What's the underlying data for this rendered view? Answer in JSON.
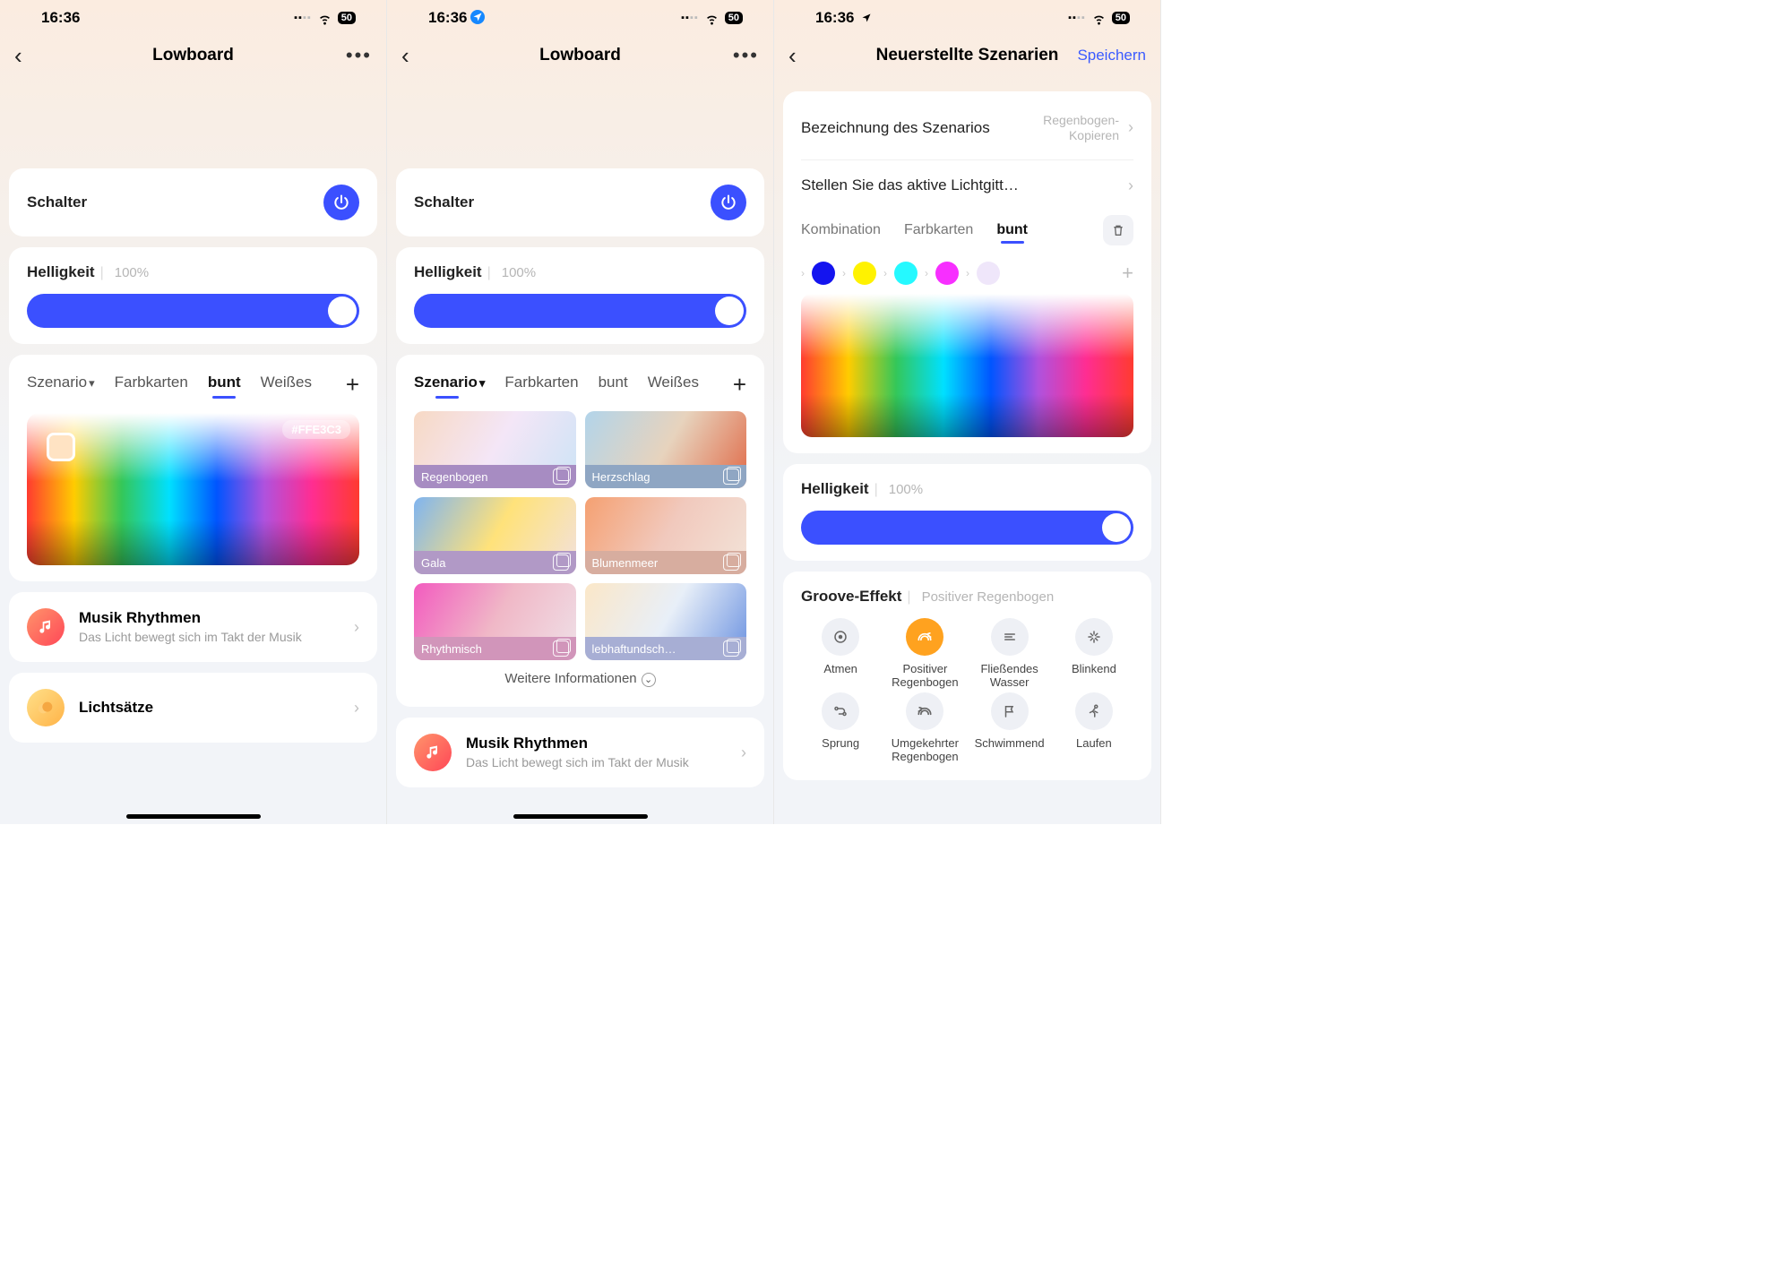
{
  "status": {
    "time": "16:36",
    "battery": "50"
  },
  "s1": {
    "title": "Lowboard",
    "switch": "Schalter",
    "brightness_label": "Helligkeit",
    "brightness_value": "100%",
    "tabs": {
      "a": "Szenario",
      "b": "Farbkarten",
      "c": "bunt",
      "d": "Weißes"
    },
    "hex": "#FFE3C3",
    "music_title": "Musik Rhythmen",
    "music_desc": "Das Licht bewegt sich im Takt der Musik",
    "light_sets": "Lichtsätze"
  },
  "s2": {
    "title": "Lowboard",
    "switch": "Schalter",
    "brightness_label": "Helligkeit",
    "brightness_value": "100%",
    "tabs": {
      "a": "Szenario",
      "b": "Farbkarten",
      "c": "bunt",
      "d": "Weißes"
    },
    "scenes": [
      "Regenbogen",
      "Herzschlag",
      "Gala",
      "Blumenmeer",
      "Rhythmisch",
      "lebhaftundsch…"
    ],
    "more": "Weitere Informationen",
    "music_title": "Musik Rhythmen",
    "music_desc": "Das Licht bewegt sich im Takt der Musik"
  },
  "s3": {
    "title": "Neuerstellte Szenarien",
    "save": "Speichern",
    "name_label": "Bezeichnung des Szenarios",
    "name_value": "Regenbogen-Kopieren",
    "active_grid": "Stellen Sie das aktive Lichtgitt…",
    "tabs": {
      "a": "Kombination",
      "b": "Farbkarten",
      "c": "bunt"
    },
    "brightness_label": "Helligkeit",
    "brightness_value": "100%",
    "fx_label": "Groove-Effekt",
    "fx_value": "Positiver Regenbogen",
    "effects": [
      "Atmen",
      "Positiver Regenbogen",
      "Fließendes Wasser",
      "Blinkend",
      "Sprung",
      "Umgekehrter Regenbogen",
      "Schwimmend",
      "Laufen"
    ]
  }
}
